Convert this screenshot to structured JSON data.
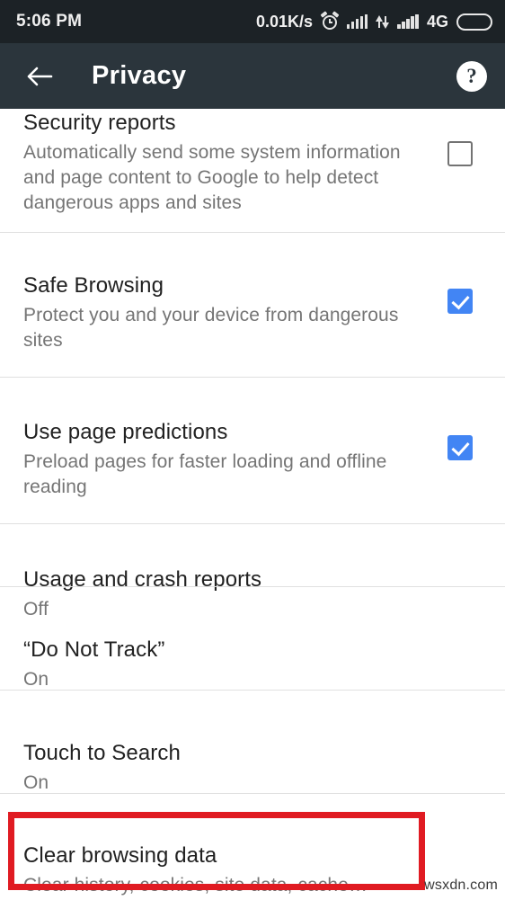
{
  "status_bar": {
    "time": "5:06 PM",
    "network_speed": "0.01K/s",
    "alarm_icon": "alarm-clock-icon",
    "signal_icon_1": "cellular-signal-icon",
    "data_sync_icon": "data-transfer-icon",
    "signal_icon_2": "cellular-signal-icon",
    "network_type": "4G",
    "battery_icon": "battery-icon",
    "colors": {
      "background": "#1c2226",
      "battery_fill": "#f5a623",
      "text": "#f0f0f0"
    }
  },
  "app_bar": {
    "back_icon": "back-arrow-icon",
    "title": "Privacy",
    "help_label": "?",
    "help_icon": "help-circle-icon",
    "colors": {
      "background": "#2b353c",
      "title": "#ffffff"
    }
  },
  "settings": {
    "items": [
      {
        "title": "Security reports",
        "summary": "Automatically send some system information and page content to Google to help detect dangerous apps and sites",
        "control": "checkbox",
        "checked": false
      },
      {
        "title": "Safe Browsing",
        "summary": "Protect you and your device from dangerous sites",
        "control": "checkbox",
        "checked": true
      },
      {
        "title": "Use page predictions",
        "summary": "Preload pages for faster loading and offline reading",
        "control": "checkbox",
        "checked": true
      },
      {
        "title": "Usage and crash reports",
        "summary": "Off",
        "control": "none",
        "checked": null
      },
      {
        "title": "“Do Not Track”",
        "summary": "On",
        "control": "none",
        "checked": null
      },
      {
        "title": "Touch to Search",
        "summary": "On",
        "control": "none",
        "checked": null
      },
      {
        "title": "Clear browsing data",
        "summary": "Clear history, cookies, site data, cache…",
        "control": "none",
        "checked": null,
        "highlighted": true
      }
    ],
    "colors": {
      "title": "#212121",
      "summary": "#757575",
      "divider": "#e0e0e0",
      "checkbox_checked": "#4285f4",
      "checkbox_unchecked_border": "#737373",
      "background": "#ffffff"
    }
  },
  "annotation": {
    "highlight_color": "#e01b22",
    "target": "Clear browsing data"
  },
  "watermark": {
    "text": "wsxdn.com"
  }
}
